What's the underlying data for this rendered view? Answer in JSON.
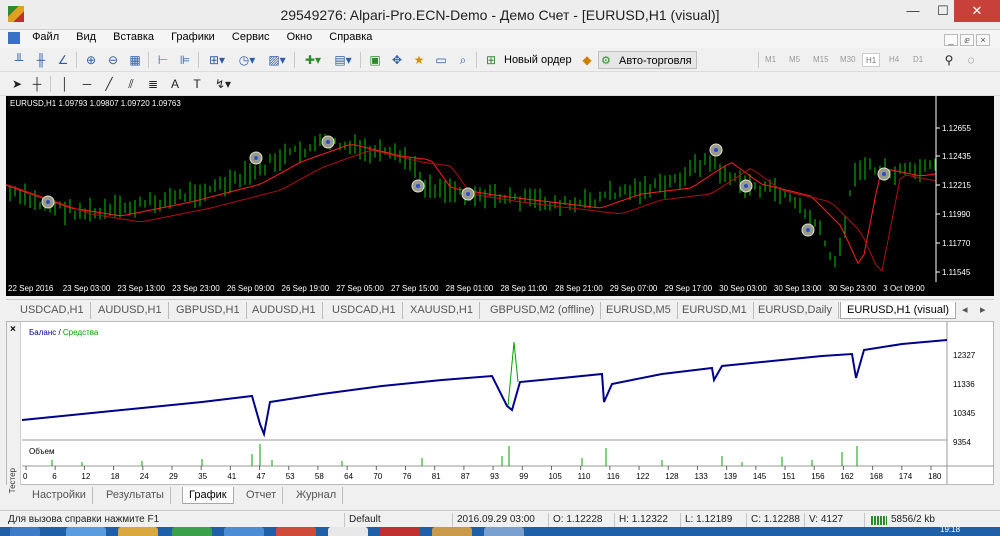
{
  "window": {
    "title": "29549276: Alpari-Pro.ECN-Demo - Демо Счет - [EURUSD,H1 (visual)]",
    "minimize": "—",
    "maximize": "☐",
    "close": "✕"
  },
  "menu": [
    "Файл",
    "Вид",
    "Вставка",
    "Графики",
    "Сервис",
    "Окно",
    "Справка"
  ],
  "mdi_buttons": [
    "_",
    "ⅇ",
    "×"
  ],
  "toolbar": {
    "new_order": "Новый ордер",
    "auto_trading": "Авто-торговля",
    "timeframes": [
      "M1",
      "M5",
      "M15",
      "M30",
      "H1",
      "H4",
      "D1"
    ],
    "active_timeframe": "H1"
  },
  "chart": {
    "header": "EURUSD,H1  1.09793 1.09807 1.09720 1.09763",
    "price_labels": [
      "1.12655",
      "1.12435",
      "1.12215",
      "1.11990",
      "1.11770",
      "1.11545"
    ],
    "time_labels": [
      "22 Sep 2016",
      "23 Sep 03:00",
      "23 Sep 13:00",
      "23 Sep 23:00",
      "26 Sep 09:00",
      "26 Sep 19:00",
      "27 Sep 05:00",
      "27 Sep 15:00",
      "28 Sep 01:00",
      "28 Sep 11:00",
      "28 Sep 21:00",
      "29 Sep 07:00",
      "29 Sep 17:00",
      "30 Sep 03:00",
      "30 Sep 13:00",
      "30 Sep 23:00",
      "3 Oct 09:00"
    ],
    "background": "#000000",
    "bull_color": "#00c800",
    "ma_color": "#ff2020"
  },
  "chart_tabs": [
    "USDCAD,H1",
    "AUDUSD,H1",
    "GBPUSD,H1",
    "AUDUSD,H1",
    "USDCAD,H1",
    "XAUUSD,H1",
    "GBPUSD,M2 (offline)",
    "EURUSD,M5",
    "EURUSD,M1",
    "EURUSD,Daily",
    "EURUSD,H1 (visual)"
  ],
  "active_chart_tab": "EURUSD,H1 (visual)",
  "tab_scroll": [
    "◂",
    "▸"
  ],
  "tester": {
    "side_label": "Тестер",
    "close": "×",
    "legend_balance": "Баланс",
    "legend_sep": " / ",
    "legend_equity": "Средства",
    "balance_color": "#00008b",
    "equity_color": "#00a000",
    "value_labels": [
      "12327",
      "11336",
      "10345",
      "9354"
    ],
    "volume_label": "Объем",
    "trade_numbers": [
      "0",
      "6",
      "12",
      "18",
      "24",
      "29",
      "35",
      "41",
      "47",
      "53",
      "58",
      "64",
      "70",
      "76",
      "81",
      "87",
      "93",
      "99",
      "105",
      "110",
      "116",
      "122",
      "128",
      "133",
      "139",
      "145",
      "151",
      "156",
      "162",
      "168",
      "174",
      "180"
    ],
    "tabs": [
      "Настройки",
      "Результаты",
      "График",
      "Отчет",
      "Журнал"
    ],
    "active_tab": "График"
  },
  "status": {
    "help": "Для вызова справки нажмите F1",
    "profile": "Default",
    "datetime": "2016.09.29 03:00",
    "open": "O: 1.12228",
    "high": "H: 1.12322",
    "low": "L: 1.12189",
    "close": "C: 1.12288",
    "volume": "V: 4127",
    "traffic": "5856/2 kb"
  },
  "taskbar": {
    "clock": "19:18"
  }
}
